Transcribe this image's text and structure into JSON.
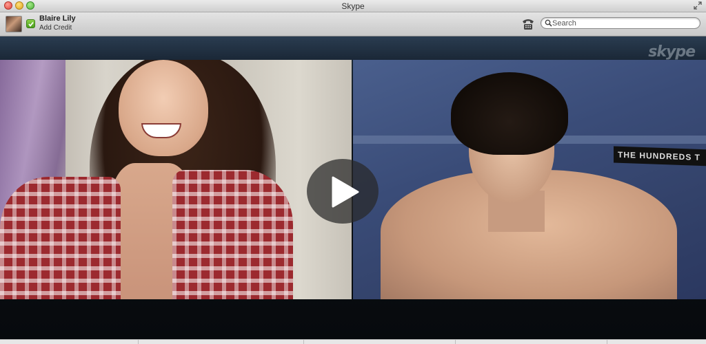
{
  "window": {
    "title": "Skype"
  },
  "account": {
    "name": "Blaire Lily",
    "credit_link": "Add Credit",
    "status": "online"
  },
  "search": {
    "placeholder": "Search",
    "value": ""
  },
  "call": {
    "brand_watermark": "skype",
    "overlay_text": "THE HUNDREDS T",
    "participants": [
      {
        "position": "left"
      },
      {
        "position": "right"
      }
    ],
    "play_control": "play"
  },
  "icons": {
    "window_close": "close-icon",
    "window_minimize": "minimize-icon",
    "window_zoom": "zoom-icon",
    "fullscreen": "fullscreen-icon",
    "status": "check-icon",
    "call": "phone-icon",
    "search": "search-icon",
    "play": "play-icon"
  },
  "colors": {
    "status_online": "#5cb82a",
    "close": "#e0443a",
    "minimize": "#e0a422",
    "zoom": "#4fb43a"
  }
}
